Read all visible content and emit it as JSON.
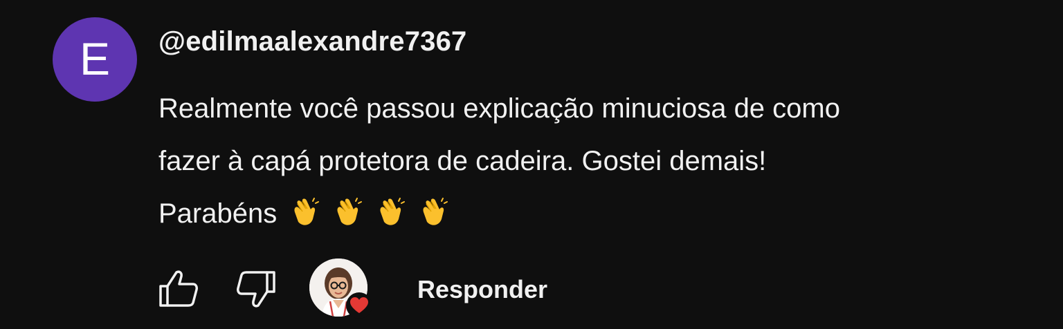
{
  "comment": {
    "avatar_letter": "E",
    "avatar_color": "#5e35b1",
    "author": "@edilmaalexandre7367",
    "text_lines": [
      "Realmente você passou explicação minuciosa de como",
      "fazer à capá protetora de cadeira. Gostei demais!",
      "Parabéns"
    ],
    "emoji_icons": [
      "clapping-hands-icon",
      "clapping-hands-icon",
      "clapping-hands-icon",
      "clapping-hands-icon"
    ]
  },
  "actions": {
    "like_icon": "thumbs-up-icon",
    "dislike_icon": "thumbs-down-icon",
    "creator_heart_icon": "heart-icon",
    "heart_color": "#e53935",
    "reply_label": "Responder"
  }
}
